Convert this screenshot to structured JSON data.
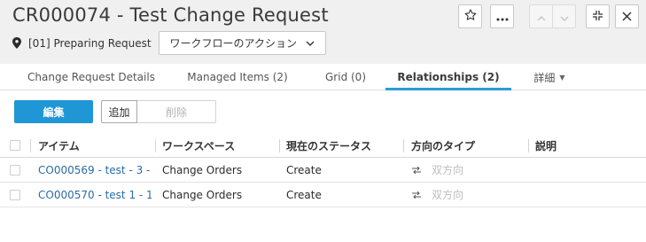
{
  "header": {
    "title": "CR000074 - Test Change Request",
    "status_text": "[01] Preparing Request",
    "workflow_button_label": "ワークフローのアクション",
    "icons": [
      "star-icon",
      "more-icon",
      "chevron-up-icon",
      "chevron-down-icon",
      "collapse-icon",
      "close-icon"
    ]
  },
  "tabs": [
    {
      "label": "Change Request Details"
    },
    {
      "label": "Managed Items (2)"
    },
    {
      "label": "Grid (0)"
    },
    {
      "label": "Relationships (2)"
    },
    {
      "label": "詳細"
    }
  ],
  "active_tab": "Relationships (2)",
  "toolbar": {
    "edit_label": "編集",
    "add_label": "追加",
    "delete_label": "削除"
  },
  "table": {
    "columns": [
      "アイテム",
      "ワークスペース",
      "現在のステータス",
      "方向のタイプ",
      "説明"
    ],
    "rows": [
      {
        "item": "CO000569 - test - 3 - ...",
        "workspace": "Change Orders",
        "status": "Create",
        "direction": "双方向",
        "description": ""
      },
      {
        "item": "CO000570 - test 1 - 1 - ...",
        "workspace": "Change Orders",
        "status": "Create",
        "direction": "双方向",
        "description": ""
      }
    ]
  },
  "colors": {
    "accent": "#1f96d6",
    "link": "#2a6ca5",
    "header_bg": "#f0f0f0"
  }
}
